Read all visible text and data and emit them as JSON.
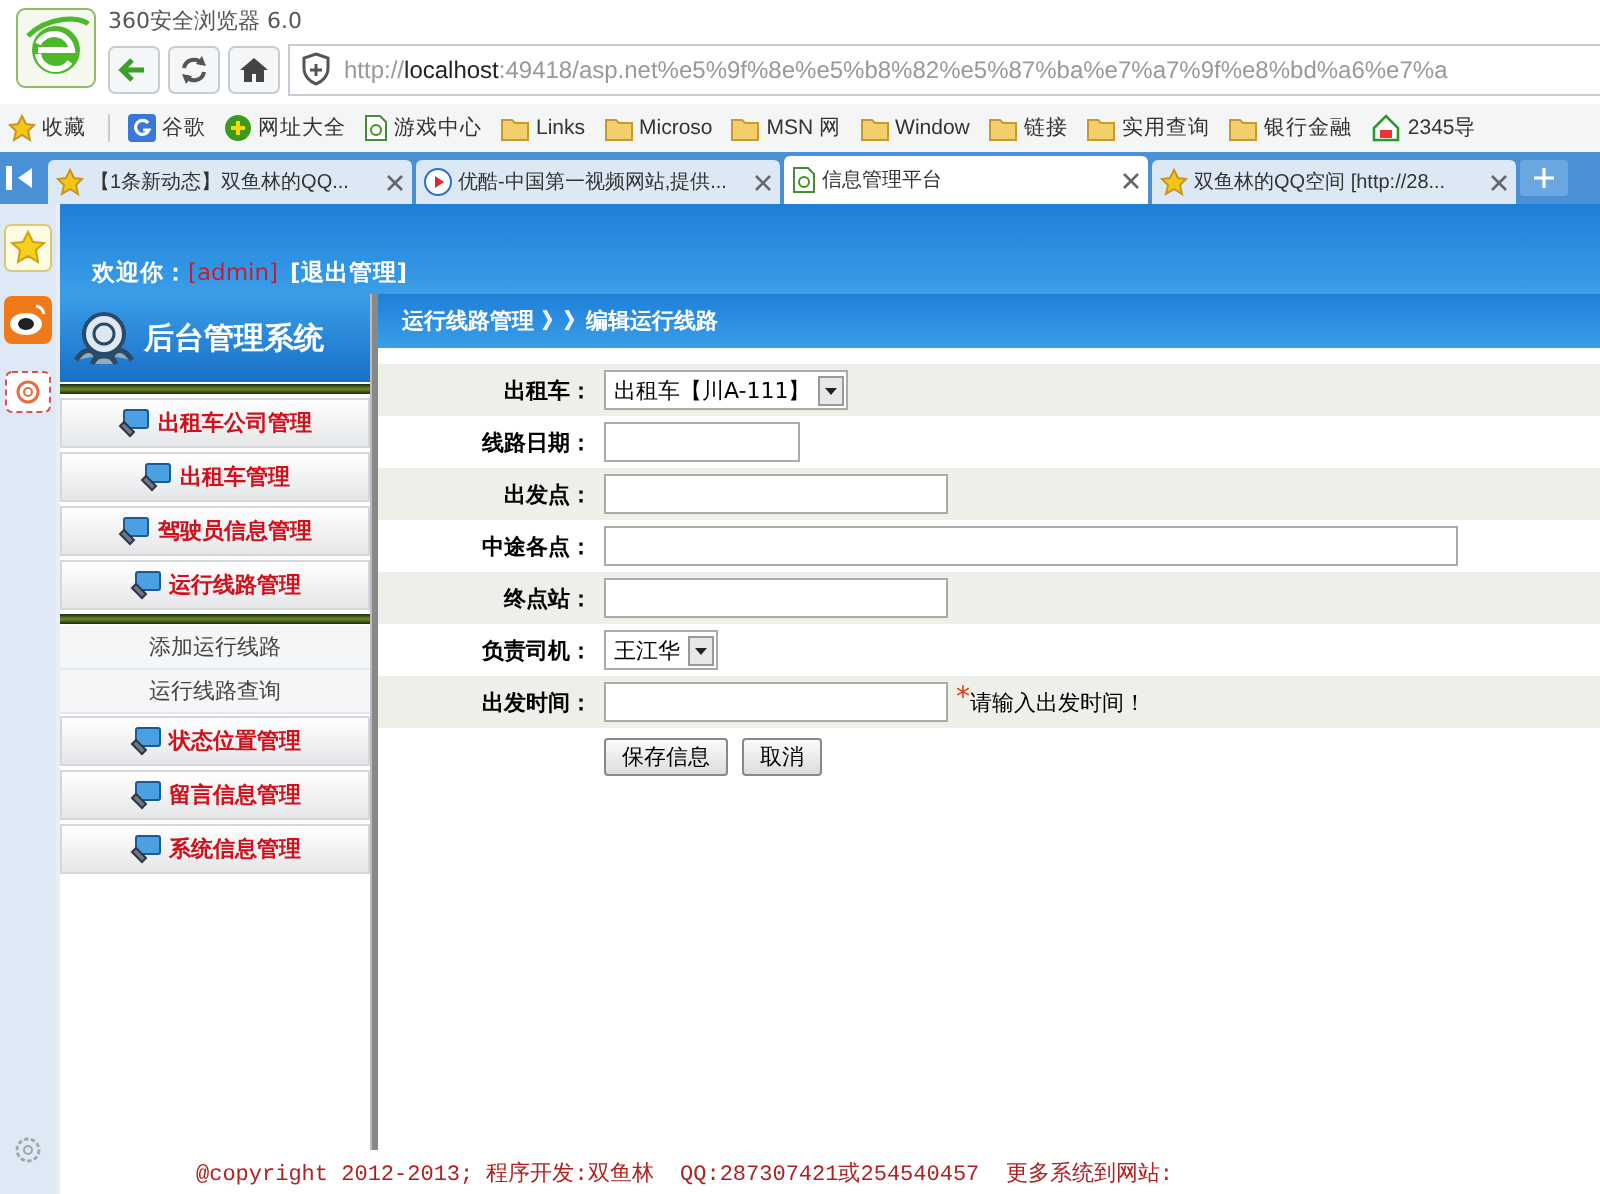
{
  "browser": {
    "title": "360安全浏览器 6.0",
    "url": {
      "scheme": "http://",
      "host": "localhost",
      "path": ":49418/asp.net%e5%9f%8e%e5%b8%82%e5%87%ba%e7%a7%9f%e8%bd%a6%e7%a"
    },
    "bookmarks": [
      {
        "label": "收藏",
        "kind": "favorites"
      },
      {
        "label": "谷歌",
        "kind": "google"
      },
      {
        "label": "网址大全",
        "kind": "plus"
      },
      {
        "label": "游戏中心",
        "kind": "page"
      },
      {
        "label": "Links",
        "kind": "folder"
      },
      {
        "label": "Microso",
        "kind": "folder"
      },
      {
        "label": "MSN 网",
        "kind": "folder"
      },
      {
        "label": "Window",
        "kind": "folder"
      },
      {
        "label": "链接",
        "kind": "folder"
      },
      {
        "label": "实用查询",
        "kind": "folder"
      },
      {
        "label": "银行金融",
        "kind": "folder"
      },
      {
        "label": "2345导",
        "kind": "house"
      }
    ],
    "tabs": [
      {
        "label": "【1条新动态】双鱼林的QQ...",
        "kind": "star",
        "selected": false
      },
      {
        "label": "优酷-中国第一视频网站,提供...",
        "kind": "play",
        "selected": false
      },
      {
        "label": "信息管理平台",
        "kind": "page",
        "selected": true
      },
      {
        "label": "双鱼林的QQ空间 [http://28...",
        "kind": "star",
        "selected": false
      }
    ]
  },
  "page": {
    "welcome": {
      "label": "欢迎你：",
      "user": "[admin]",
      "logout": "[退出管理]"
    },
    "sidebar": {
      "title": "后台管理系统",
      "items": [
        {
          "label": "出租车公司管理"
        },
        {
          "label": "出租车管理"
        },
        {
          "label": "驾驶员信息管理"
        },
        {
          "label": "运行线路管理",
          "children": [
            {
              "label": "添加运行线路"
            },
            {
              "label": "运行线路查询"
            }
          ]
        },
        {
          "label": "状态位置管理"
        },
        {
          "label": "留言信息管理"
        },
        {
          "label": "系统信息管理"
        }
      ]
    },
    "breadcrumb": "运行线路管理 》》编辑运行线路",
    "form": {
      "rows": [
        {
          "label": "出租车：",
          "kind": "select",
          "value": "出租车【川A-111】"
        },
        {
          "label": "线路日期：",
          "kind": "date"
        },
        {
          "label": "出发点：",
          "kind": "text"
        },
        {
          "label": "中途各点：",
          "kind": "longtext"
        },
        {
          "label": "终点站：",
          "kind": "text"
        },
        {
          "label": "负责司机：",
          "kind": "select",
          "value": "王江华"
        },
        {
          "label": "出发时间：",
          "kind": "text",
          "required_mark": "*",
          "hint": "请输入出发时间！"
        }
      ],
      "buttons": [
        "保存信息",
        "取消"
      ]
    },
    "footer": "@copyright 2012-2013; 程序开发:双鱼林  QQ:287307421或254540457  更多系统到网站:"
  }
}
